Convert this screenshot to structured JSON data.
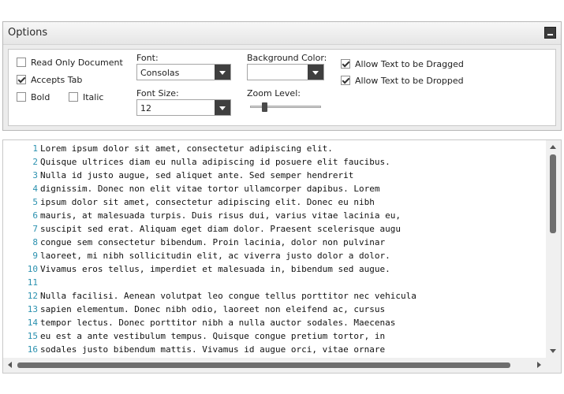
{
  "options": {
    "title": "Options",
    "read_only_label": "Read Only Document",
    "read_only_checked": false,
    "accepts_tab_label": "Accepts Tab",
    "accepts_tab_checked": true,
    "bold_label": "Bold",
    "bold_checked": false,
    "italic_label": "Italic",
    "italic_checked": false,
    "font_label": "Font:",
    "font_value": "Consolas",
    "font_size_label": "Font Size:",
    "font_size_value": "12",
    "background_color_label": "Background Color:",
    "background_color_value": "",
    "zoom_label": "Zoom Level:",
    "zoom_level_fraction": 0.2,
    "allow_drag_label": "Allow Text to be Dragged",
    "allow_drag_checked": true,
    "allow_drop_label": "Allow Text to be Dropped",
    "allow_drop_checked": true
  },
  "editor": {
    "lines": [
      {
        "num": "1",
        "text": "Lorem ipsum dolor sit amet, consectetur adipiscing elit."
      },
      {
        "num": "2",
        "text": "Quisque ultrices diam eu nulla adipiscing id posuere elit faucibus."
      },
      {
        "num": "3",
        "text": "Nulla id justo augue, sed aliquet ante. Sed semper hendrerit"
      },
      {
        "num": "4",
        "text": "dignissim. Donec non elit vitae tortor ullamcorper dapibus. Lorem"
      },
      {
        "num": "5",
        "text": "ipsum dolor sit amet, consectetur adipiscing elit. Donec eu nibh"
      },
      {
        "num": "6",
        "text": "mauris, at malesuada turpis. Duis risus dui, varius vitae lacinia eu,"
      },
      {
        "num": "7",
        "text": "suscipit sed erat. Aliquam eget diam dolor. Praesent scelerisque augu"
      },
      {
        "num": "8",
        "text": "congue sem consectetur bibendum. Proin lacinia, dolor non pulvinar"
      },
      {
        "num": "9",
        "text": "laoreet, mi nibh sollicitudin elit, ac viverra justo dolor a dolor."
      },
      {
        "num": "10",
        "text": "Vivamus eros tellus, imperdiet et malesuada in, bibendum sed augue."
      },
      {
        "num": "11",
        "text": ""
      },
      {
        "num": "12",
        "text": "Nulla facilisi. Aenean volutpat leo congue tellus porttitor nec vehicula"
      },
      {
        "num": "13",
        "text": "sapien elementum. Donec nibh odio, laoreet non eleifend ac, cursus"
      },
      {
        "num": "14",
        "text": "tempor lectus. Donec porttitor nibh a nulla auctor sodales. Maecenas"
      },
      {
        "num": "15",
        "text": "eu est a ante vestibulum tempus. Quisque congue pretium tortor, in"
      },
      {
        "num": "16",
        "text": "sodales justo bibendum mattis. Vivamus id augue orci, vitae ornare"
      }
    ]
  }
}
